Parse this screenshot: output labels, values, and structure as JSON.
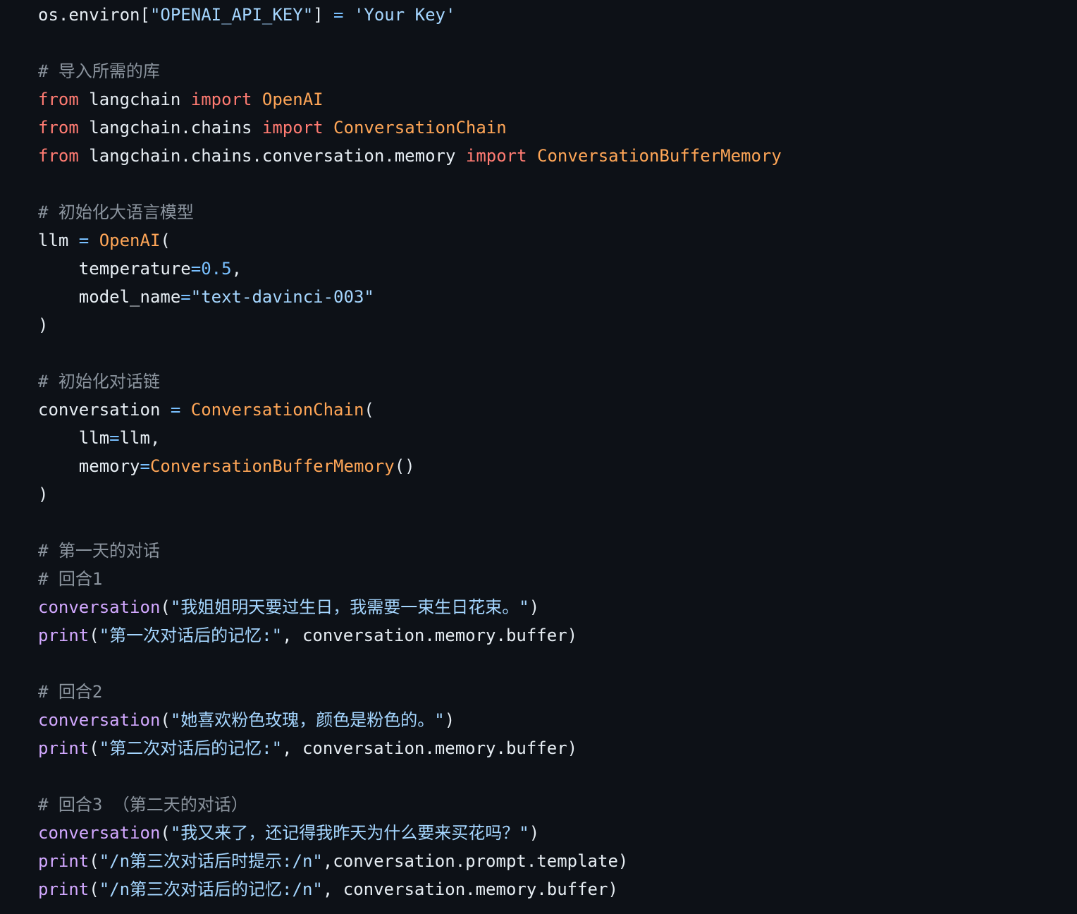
{
  "editor": {
    "theme_colors": {
      "background": "#0d1117",
      "plain": "#e6edf3",
      "keyword": "#ff7b72",
      "class": "#ffa657",
      "string": "#a5d6ff",
      "operator": "#79c0ff",
      "function": "#d2a8ff",
      "comment": "#8b949e"
    },
    "cursor": {
      "line": 11,
      "after_token": 2
    },
    "lines": [
      [
        {
          "text": "os.environ[",
          "kind": "plain"
        },
        {
          "text": "\"OPENAI_API_KEY\"",
          "kind": "str"
        },
        {
          "text": "] ",
          "kind": "plain"
        },
        {
          "text": "=",
          "kind": "op"
        },
        {
          "text": " ",
          "kind": "plain"
        },
        {
          "text": "'Your Key'",
          "kind": "str"
        }
      ],
      [],
      [
        {
          "text": "# 导入所需的库",
          "kind": "comment"
        }
      ],
      [
        {
          "text": "from",
          "kind": "kw"
        },
        {
          "text": " langchain ",
          "kind": "plain"
        },
        {
          "text": "import",
          "kind": "kw"
        },
        {
          "text": " ",
          "kind": "plain"
        },
        {
          "text": "OpenAI",
          "kind": "class"
        }
      ],
      [
        {
          "text": "from",
          "kind": "kw"
        },
        {
          "text": " langchain.chains ",
          "kind": "plain"
        },
        {
          "text": "import",
          "kind": "kw"
        },
        {
          "text": " ",
          "kind": "plain"
        },
        {
          "text": "ConversationChain",
          "kind": "class"
        }
      ],
      [
        {
          "text": "from",
          "kind": "kw"
        },
        {
          "text": " langchain.chains.conversation.memory ",
          "kind": "plain"
        },
        {
          "text": "import",
          "kind": "kw"
        },
        {
          "text": " ",
          "kind": "plain"
        },
        {
          "text": "ConversationBufferMemory",
          "kind": "class"
        }
      ],
      [],
      [
        {
          "text": "# 初始化大语言模型",
          "kind": "comment"
        }
      ],
      [
        {
          "text": "llm ",
          "kind": "plain"
        },
        {
          "text": "=",
          "kind": "op"
        },
        {
          "text": " ",
          "kind": "plain"
        },
        {
          "text": "OpenAI",
          "kind": "class"
        },
        {
          "text": "(",
          "kind": "plain"
        }
      ],
      [
        {
          "text": "    temperature",
          "kind": "plain"
        },
        {
          "text": "=",
          "kind": "op"
        },
        {
          "text": "0.5",
          "kind": "num"
        },
        {
          "text": ",",
          "kind": "plain"
        }
      ],
      [
        {
          "text": "    model_name",
          "kind": "plain"
        },
        {
          "text": "=",
          "kind": "op"
        },
        {
          "text": "\"text-davinci-003\"",
          "kind": "str"
        }
      ],
      [
        {
          "text": ")",
          "kind": "plain"
        }
      ],
      [],
      [
        {
          "text": "# 初始化对话链",
          "kind": "comment"
        }
      ],
      [
        {
          "text": "conversation ",
          "kind": "plain"
        },
        {
          "text": "=",
          "kind": "op"
        },
        {
          "text": " ",
          "kind": "plain"
        },
        {
          "text": "ConversationChain",
          "kind": "class"
        },
        {
          "text": "(",
          "kind": "plain"
        }
      ],
      [
        {
          "text": "    llm",
          "kind": "plain"
        },
        {
          "text": "=",
          "kind": "op"
        },
        {
          "text": "llm,",
          "kind": "plain"
        }
      ],
      [
        {
          "text": "    memory",
          "kind": "plain"
        },
        {
          "text": "=",
          "kind": "op"
        },
        {
          "text": "ConversationBufferMemory",
          "kind": "class"
        },
        {
          "text": "()",
          "kind": "plain"
        }
      ],
      [
        {
          "text": ")",
          "kind": "plain"
        }
      ],
      [],
      [
        {
          "text": "# 第一天的对话",
          "kind": "comment"
        }
      ],
      [
        {
          "text": "# 回合1",
          "kind": "comment"
        }
      ],
      [
        {
          "text": "conversation",
          "kind": "func"
        },
        {
          "text": "(",
          "kind": "plain"
        },
        {
          "text": "\"我姐姐明天要过生日，我需要一束生日花束。\"",
          "kind": "str"
        },
        {
          "text": ")",
          "kind": "plain"
        }
      ],
      [
        {
          "text": "print",
          "kind": "func"
        },
        {
          "text": "(",
          "kind": "plain"
        },
        {
          "text": "\"第一次对话后的记忆:\"",
          "kind": "str"
        },
        {
          "text": ", conversation.memory.buffer)",
          "kind": "plain"
        }
      ],
      [],
      [
        {
          "text": "# 回合2",
          "kind": "comment"
        }
      ],
      [
        {
          "text": "conversation",
          "kind": "func"
        },
        {
          "text": "(",
          "kind": "plain"
        },
        {
          "text": "\"她喜欢粉色玫瑰，颜色是粉色的。\"",
          "kind": "str"
        },
        {
          "text": ")",
          "kind": "plain"
        }
      ],
      [
        {
          "text": "print",
          "kind": "func"
        },
        {
          "text": "(",
          "kind": "plain"
        },
        {
          "text": "\"第二次对话后的记忆:\"",
          "kind": "str"
        },
        {
          "text": ", conversation.memory.buffer)",
          "kind": "plain"
        }
      ],
      [],
      [
        {
          "text": "# 回合3 （第二天的对话）",
          "kind": "comment"
        }
      ],
      [
        {
          "text": "conversation",
          "kind": "func"
        },
        {
          "text": "(",
          "kind": "plain"
        },
        {
          "text": "\"我又来了，还记得我昨天为什么要来买花吗？\"",
          "kind": "str"
        },
        {
          "text": ")",
          "kind": "plain"
        }
      ],
      [
        {
          "text": "print",
          "kind": "func"
        },
        {
          "text": "(",
          "kind": "plain"
        },
        {
          "text": "\"/n第三次对话后时提示:/n\"",
          "kind": "str"
        },
        {
          "text": ",conversation.prompt.template)",
          "kind": "plain"
        }
      ],
      [
        {
          "text": "print",
          "kind": "func"
        },
        {
          "text": "(",
          "kind": "plain"
        },
        {
          "text": "\"/n第三次对话后的记忆:/n\"",
          "kind": "str"
        },
        {
          "text": ", conversation.memory.buffer)",
          "kind": "plain"
        }
      ]
    ]
  }
}
